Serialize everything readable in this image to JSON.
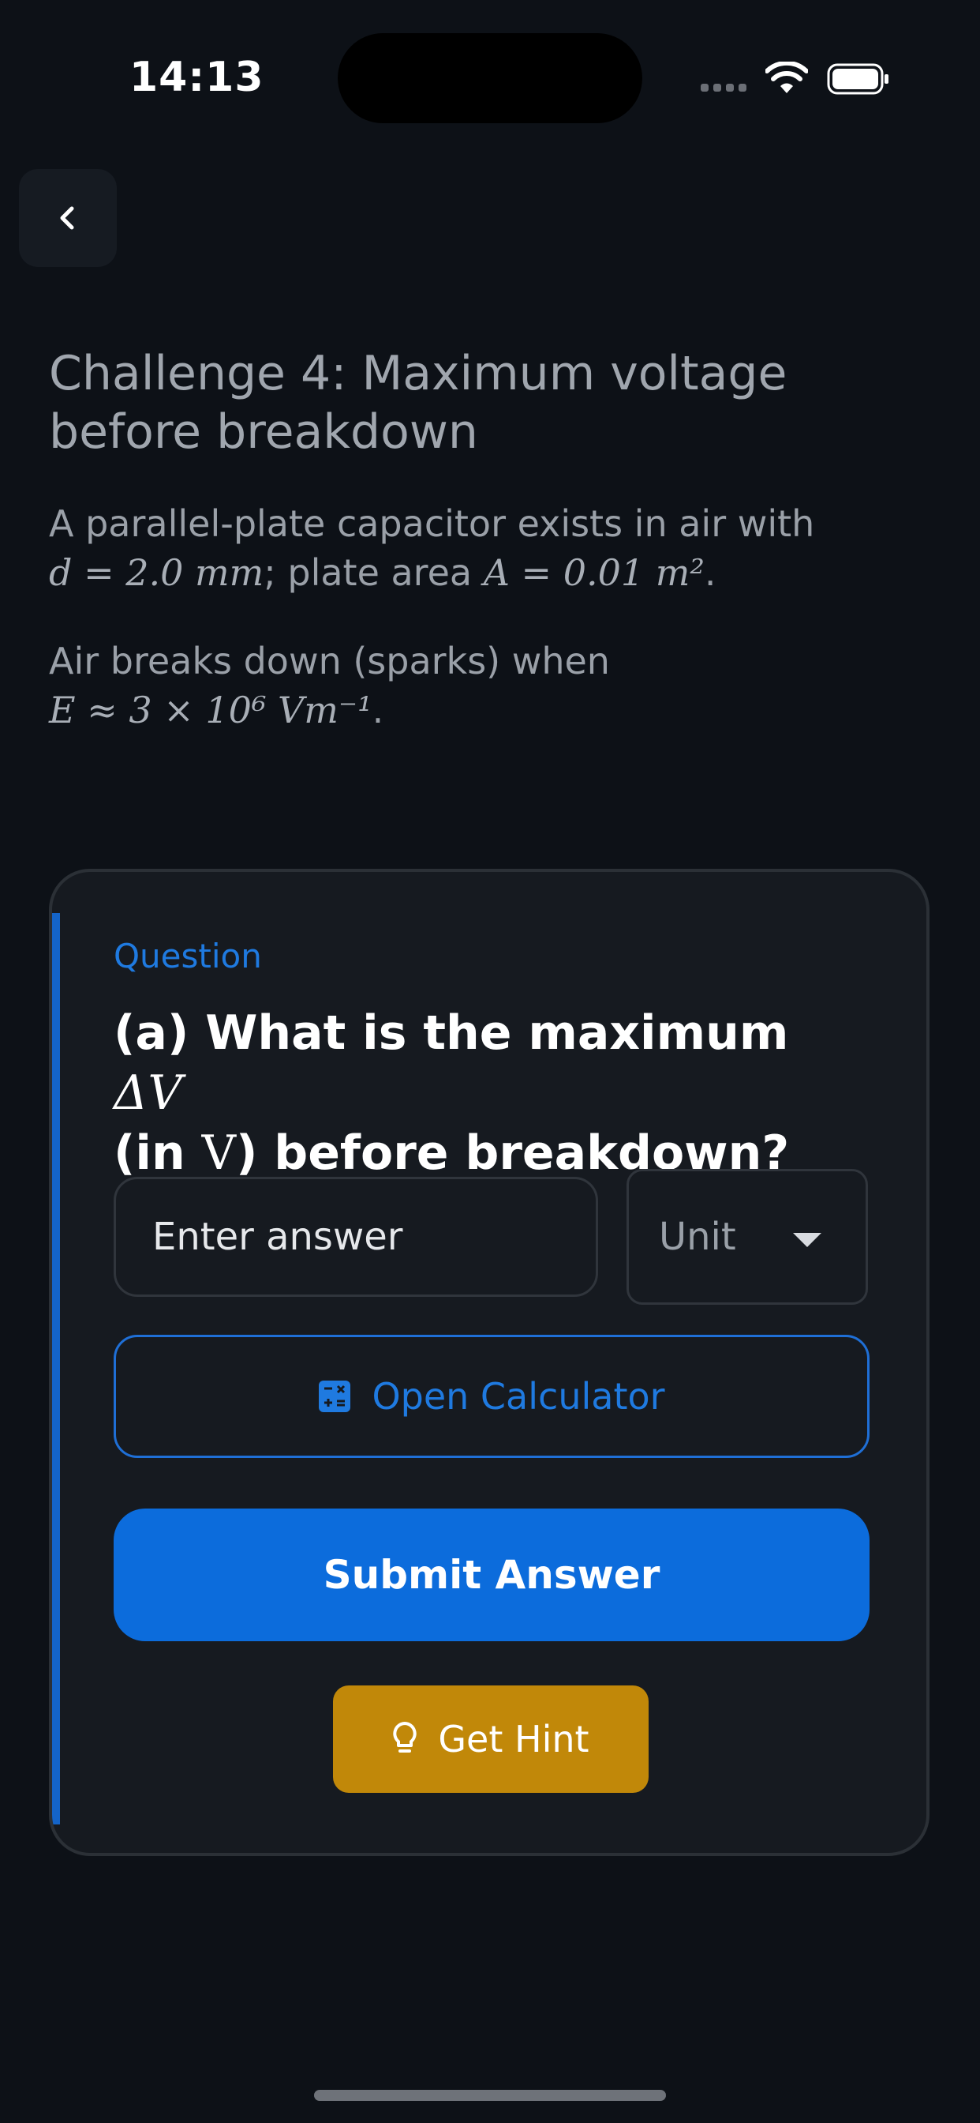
{
  "status_bar": {
    "time": "14:13"
  },
  "nav": {
    "back_icon": "chevron-left-icon"
  },
  "challenge": {
    "title": "Challenge 4: Maximum voltage before breakdown",
    "line1_prefix": "A parallel-plate capacitor exists in air with",
    "line1_math_d": "d = 2.0 mm",
    "line1_mid": "; plate area",
    "line1_math_A": "A = 0.01 m²",
    "line1_end": ".",
    "line2_prefix": "Air breaks down (sparks) when",
    "line2_math_E": "E ≈ 3 × 10⁶ Vm⁻¹",
    "line2_end": "."
  },
  "question": {
    "label": "Question",
    "text_prefix": "(a) What is the maximum",
    "text_math1": "ΔV",
    "text_mid": "(in",
    "text_math2": "V",
    "text_suffix": ") before breakdown?",
    "answer_placeholder": "Enter answer",
    "unit_selected": "Unit",
    "calculator_label": "Open Calculator",
    "submit_label": "Submit Answer",
    "hint_label": "Get Hint"
  },
  "colors": {
    "background": "#0d1117",
    "accent_blue": "#0c6cdc",
    "hint_gold": "#c18809"
  }
}
